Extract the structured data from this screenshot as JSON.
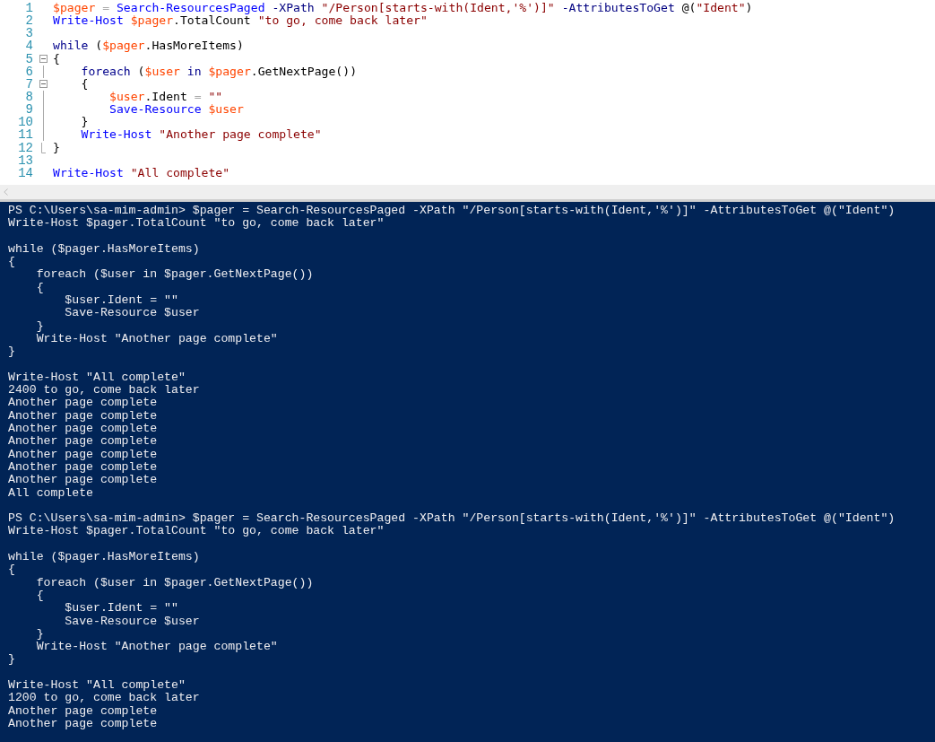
{
  "editor": {
    "lines": [
      {
        "number": "1",
        "kind": "none",
        "tokens": [
          {
            "kind": "variable",
            "text": "$pager"
          },
          {
            "kind": "operator",
            "text": " ="
          },
          {
            "kind": "command",
            "text": " Search-ResourcesPaged"
          },
          {
            "kind": "parameter",
            "text": " -XPath"
          },
          {
            "kind": "string",
            "text": " \"/Person[starts-with(Ident,'%')]\""
          },
          {
            "kind": "parameter",
            "text": " -AttributesToGet"
          },
          {
            "kind": "plain",
            "text": " @("
          },
          {
            "kind": "string",
            "text": "\"Ident\""
          },
          {
            "kind": "plain",
            "text": ")"
          }
        ]
      },
      {
        "number": "2",
        "kind": "none",
        "tokens": [
          {
            "kind": "command",
            "text": "Write-Host"
          },
          {
            "kind": "variable",
            "text": " $pager"
          },
          {
            "kind": "plain",
            "text": ".TotalCount"
          },
          {
            "kind": "string",
            "text": " \"to go, come back later\""
          }
        ]
      },
      {
        "number": "3",
        "kind": "none"
      },
      {
        "number": "4",
        "kind": "none",
        "tokens": [
          {
            "kind": "keyword",
            "text": "while"
          },
          {
            "kind": "plain",
            "text": " ("
          },
          {
            "kind": "variable",
            "text": "$pager"
          },
          {
            "kind": "plain",
            "text": ".HasMoreItems)"
          }
        ]
      },
      {
        "number": "5",
        "kind": "start",
        "tokens": [
          {
            "kind": "plain",
            "text": "{"
          }
        ]
      },
      {
        "number": "6",
        "kind": "body",
        "tokens": [
          {
            "kind": "keyword",
            "text": "    foreach"
          },
          {
            "kind": "plain",
            "text": " ("
          },
          {
            "kind": "variable",
            "text": "$user"
          },
          {
            "kind": "keyword",
            "text": " in"
          },
          {
            "kind": "variable",
            "text": " $pager"
          },
          {
            "kind": "plain",
            "text": ".GetNextPage())"
          }
        ]
      },
      {
        "number": "7",
        "kind": "start",
        "tokens": [
          {
            "kind": "plain",
            "text": "    {"
          }
        ]
      },
      {
        "number": "8",
        "kind": "body",
        "tokens": [
          {
            "kind": "variable",
            "text": "        $user"
          },
          {
            "kind": "plain",
            "text": ".Ident"
          },
          {
            "kind": "operator",
            "text": " ="
          },
          {
            "kind": "string",
            "text": " \"\""
          }
        ]
      },
      {
        "number": "9",
        "kind": "body",
        "tokens": [
          {
            "kind": "command",
            "text": "        Save-Resource"
          },
          {
            "kind": "variable",
            "text": " $user"
          }
        ]
      },
      {
        "number": "10",
        "kind": "body",
        "tokens": [
          {
            "kind": "plain",
            "text": "    }"
          }
        ]
      },
      {
        "number": "11",
        "kind": "body",
        "tokens": [
          {
            "kind": "command",
            "text": "    Write-Host"
          },
          {
            "kind": "string",
            "text": " \"Another page complete\""
          }
        ]
      },
      {
        "number": "12",
        "kind": "end",
        "tokens": [
          {
            "kind": "plain",
            "text": "}"
          }
        ]
      },
      {
        "number": "13",
        "kind": "none"
      },
      {
        "number": "14",
        "kind": "none",
        "tokens": [
          {
            "kind": "command",
            "text": "Write-Host"
          },
          {
            "kind": "string",
            "text": " \"All complete\""
          }
        ]
      }
    ]
  },
  "console": {
    "blocks": [
      [
        "PS C:\\Users\\sa-mim-admin> $pager = Search-ResourcesPaged -XPath \"/Person[starts-with(Ident,'%')]\" -AttributesToGet @(\"Ident\")",
        "Write-Host $pager.TotalCount \"to go, come back later\""
      ],
      [
        "while ($pager.HasMoreItems)",
        "{",
        "    foreach ($user in $pager.GetNextPage())",
        "    {",
        "        $user.Ident = \"\"",
        "        Save-Resource $user",
        "    }",
        "    Write-Host \"Another page complete\"",
        "}"
      ],
      [
        "Write-Host \"All complete\"",
        "2400 to go, come back later",
        "Another page complete",
        "Another page complete",
        "Another page complete",
        "Another page complete",
        "Another page complete",
        "Another page complete",
        "Another page complete",
        "All complete"
      ],
      [
        "PS C:\\Users\\sa-mim-admin> $pager = Search-ResourcesPaged -XPath \"/Person[starts-with(Ident,'%')]\" -AttributesToGet @(\"Ident\")",
        "Write-Host $pager.TotalCount \"to go, come back later\""
      ],
      [
        "while ($pager.HasMoreItems)",
        "{",
        "    foreach ($user in $pager.GetNextPage())",
        "    {",
        "        $user.Ident = \"\"",
        "        Save-Resource $user",
        "    }",
        "    Write-Host \"Another page complete\"",
        "}"
      ],
      [
        "Write-Host \"All complete\"",
        "1200 to go, come back later",
        "Another page complete",
        "Another page complete"
      ]
    ]
  }
}
